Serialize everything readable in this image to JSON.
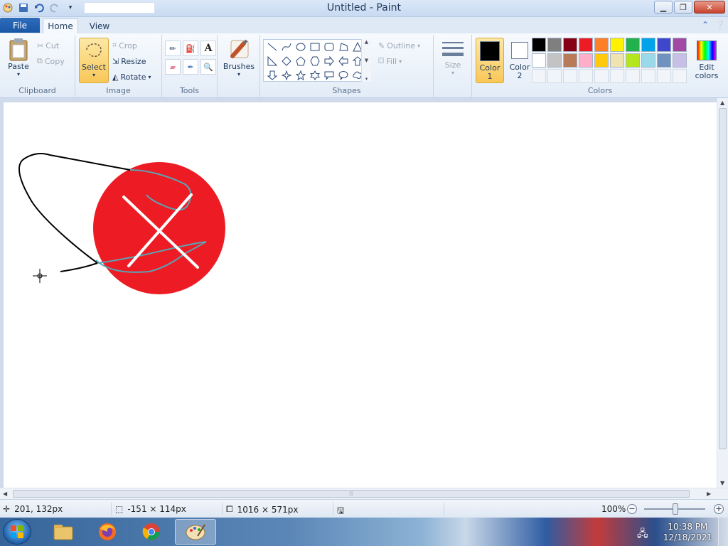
{
  "window": {
    "title": "Untitled - Paint",
    "minimize_icon": "minimize-icon",
    "maximize_icon": "restore-icon",
    "close_icon": "close-icon"
  },
  "tabs": {
    "file": "File",
    "home": "Home",
    "view": "View"
  },
  "ribbon": {
    "clipboard": {
      "label": "Clipboard",
      "paste": "Paste",
      "cut": "Cut",
      "copy": "Copy"
    },
    "image": {
      "label": "Image",
      "select": "Select",
      "crop": "Crop",
      "resize": "Resize",
      "rotate": "Rotate"
    },
    "tools": {
      "label": "Tools"
    },
    "brushes": {
      "label": "Brushes"
    },
    "shapes": {
      "label": "Shapes",
      "outline": "Outline",
      "fill": "Fill"
    },
    "size": {
      "label": "Size"
    },
    "colors": {
      "label": "Colors",
      "color1_a": "Color",
      "color1_b": "1",
      "color2_a": "Color",
      "color2_b": "2",
      "edit_a": "Edit",
      "edit_b": "colors",
      "color1_value": "#000000",
      "color2_value": "#ffffff",
      "palette": [
        "#000000",
        "#7f7f7f",
        "#880015",
        "#ed1c24",
        "#ff7f27",
        "#fff200",
        "#22b14c",
        "#00a2e8",
        "#3f48cc",
        "#a349a4",
        "#ffffff",
        "#c3c3c3",
        "#b97a57",
        "#ffaec9",
        "#ffc90e",
        "#efe4b0",
        "#b5e61d",
        "#99d9ea",
        "#7092be",
        "#c8bfe7"
      ]
    }
  },
  "canvas": {
    "circle_color": "#ed1c24",
    "stroke_black": "#000000",
    "stroke_teal": "#5ba3b5",
    "stroke_white": "#ffffff"
  },
  "statusbar": {
    "cursor_pos": "201, 132px",
    "selection_size": "-151 × 114px",
    "image_size": "1016 × 571px",
    "zoom": "100%"
  },
  "taskbar": {
    "time": "10:38 PM",
    "date": "12/18/2021",
    "apps": [
      "start-icon",
      "file-explorer-icon",
      "firefox-icon",
      "chrome-icon",
      "paint-icon"
    ]
  }
}
